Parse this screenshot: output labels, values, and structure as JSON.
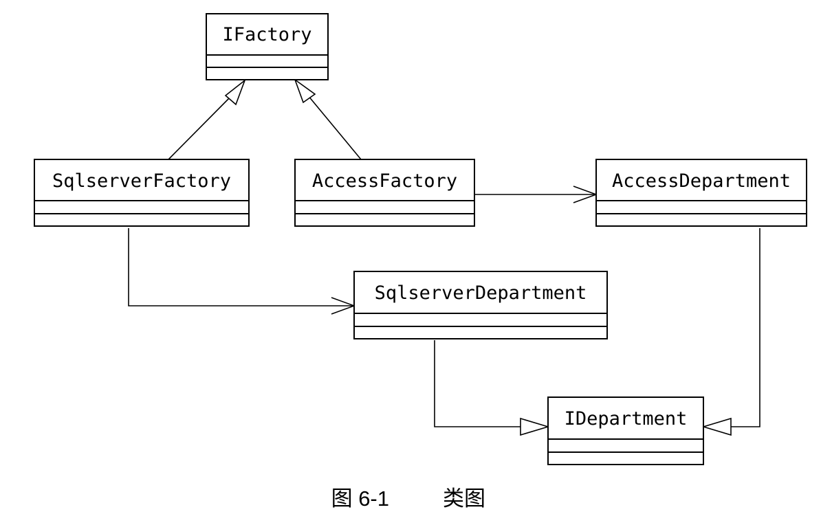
{
  "classes": {
    "ifactory": "IFactory",
    "sqlserver_factory": "SqlserverFactory",
    "access_factory": "AccessFactory",
    "access_department": "AccessDepartment",
    "sqlserver_department": "SqlserverDepartment",
    "idepartment": "IDepartment"
  },
  "relationships": [
    {
      "from": "SqlserverFactory",
      "to": "IFactory",
      "type": "realization"
    },
    {
      "from": "AccessFactory",
      "to": "IFactory",
      "type": "realization"
    },
    {
      "from": "AccessFactory",
      "to": "AccessDepartment",
      "type": "dependency"
    },
    {
      "from": "SqlserverFactory",
      "to": "SqlserverDepartment",
      "type": "dependency"
    },
    {
      "from": "SqlserverDepartment",
      "to": "IDepartment",
      "type": "realization"
    },
    {
      "from": "AccessDepartment",
      "to": "IDepartment",
      "type": "realization"
    }
  ],
  "caption": {
    "figure_label": "图 6-1",
    "title": "类图"
  }
}
